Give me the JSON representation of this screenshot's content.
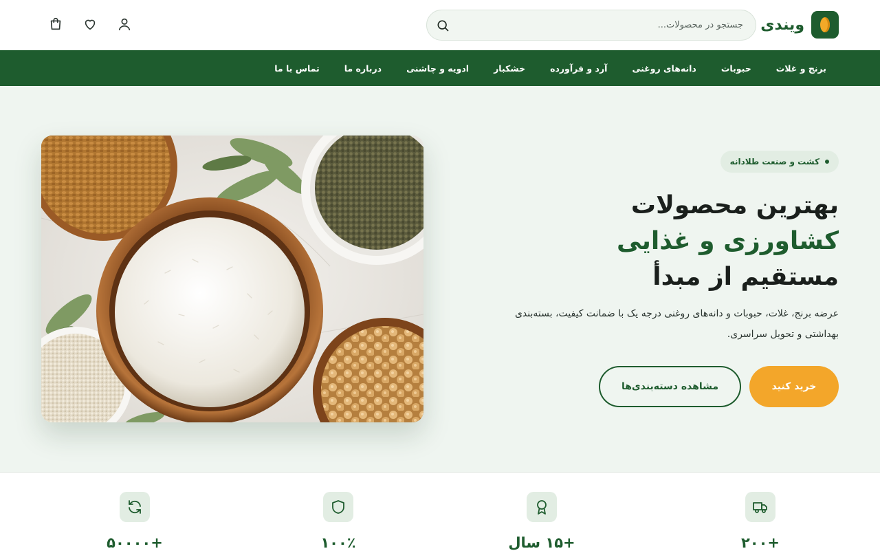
{
  "brand": {
    "name": "ویندی",
    "colors": {
      "primary": "#1e5c2e",
      "accent": "#f3a62a",
      "hero_bg": "#eff5f0"
    }
  },
  "header": {
    "search": {
      "placeholder": "جستجو در محصولات...",
      "icon": "search-icon"
    },
    "icons": [
      "user-icon",
      "heart-icon",
      "cart-icon"
    ]
  },
  "nav": {
    "items": [
      "برنج و غلات",
      "حبوبات",
      "دانه‌های روغنی",
      "آرد و فرآورده",
      "خشکبار",
      "ادویه و چاشنی",
      "درباره ما",
      "تماس با ما"
    ]
  },
  "hero": {
    "badge": "کشت و صنعت طلادانه",
    "title_line1": "بهترین محصولات",
    "title_line2": "کشاورزی و غذایی",
    "title_line3": "مستقیم از مبدأ",
    "description": "عرضه برنج، غلات، حبوبات و دانه‌های روغنی درجه یک با ضمانت کیفیت، بسته‌بندی بهداشتی و تحویل سراسری.",
    "primary_button": "خرید کنید",
    "secondary_button": "مشاهده دسته‌بندی‌ها"
  },
  "stats": [
    {
      "icon": "truck-icon",
      "value": "+۲۰۰"
    },
    {
      "icon": "award-icon",
      "value": "+۱۵ سال"
    },
    {
      "icon": "shield-icon",
      "value": "۱۰۰٪"
    },
    {
      "icon": "refresh-icon",
      "value": "+۵۰۰۰۰"
    }
  ]
}
